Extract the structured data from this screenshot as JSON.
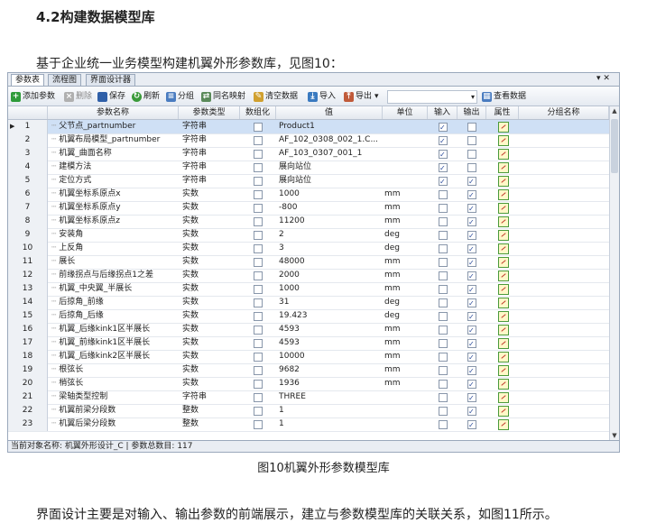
{
  "doc": {
    "heading": "4.2构建数据模型库",
    "intro": "基于企业统一业务模型构建机翼外形参数库，见图10：",
    "caption": "图10机翼外形参数模型库",
    "outro": "界面设计主要是对输入、输出参数的前端展示，建立与参数模型库的关联关系，如图11所示。"
  },
  "window": {
    "tabs": [
      "参数表",
      "流程图",
      "界面设计器"
    ],
    "controls": "▾ ✕"
  },
  "toolbar": {
    "add": "添加参数",
    "delete": "删除",
    "save": "保存",
    "refresh": "刷新",
    "group": "分组",
    "same_name_map": "同名映射",
    "clear_data": "清空数据",
    "import": "导入",
    "export": "导出",
    "export_arrow": "▾",
    "view_data": "查看数据"
  },
  "table": {
    "columns": [
      "参数名称",
      "参数类型",
      "数组化",
      "值",
      "单位",
      "输入",
      "输出",
      "属性",
      "分组名称"
    ],
    "rows": [
      {
        "n": "1",
        "name": "父节点_partnumber",
        "type": "字符串",
        "arr": false,
        "value": "Product1",
        "unit": "",
        "in": true,
        "out": false,
        "sel": true
      },
      {
        "n": "2",
        "name": "机翼布局模型_partnumber",
        "type": "字符串",
        "arr": false,
        "value": "AF_102_0308_002_1.C...",
        "unit": "",
        "in": true,
        "out": false
      },
      {
        "n": "3",
        "name": "机翼_曲面名称",
        "type": "字符串",
        "arr": false,
        "value": "AF_103_0307_001_1",
        "unit": "",
        "in": true,
        "out": false
      },
      {
        "n": "4",
        "name": "建模方法",
        "type": "字符串",
        "arr": false,
        "value": "展向站位",
        "unit": "",
        "in": true,
        "out": false
      },
      {
        "n": "5",
        "name": "定位方式",
        "type": "字符串",
        "arr": false,
        "value": "展向站位",
        "unit": "",
        "in": true,
        "out": true
      },
      {
        "n": "6",
        "name": "机翼坐标系原点x",
        "type": "实数",
        "arr": false,
        "value": "1000",
        "unit": "mm",
        "in": false,
        "out": true
      },
      {
        "n": "7",
        "name": "机翼坐标系原点y",
        "type": "实数",
        "arr": false,
        "value": "-800",
        "unit": "mm",
        "in": false,
        "out": true
      },
      {
        "n": "8",
        "name": "机翼坐标系原点z",
        "type": "实数",
        "arr": false,
        "value": "11200",
        "unit": "mm",
        "in": false,
        "out": true
      },
      {
        "n": "9",
        "name": "安装角",
        "type": "实数",
        "arr": false,
        "value": "2",
        "unit": "deg",
        "in": false,
        "out": true
      },
      {
        "n": "10",
        "name": "上反角",
        "type": "实数",
        "arr": false,
        "value": "3",
        "unit": "deg",
        "in": false,
        "out": true
      },
      {
        "n": "11",
        "name": "展长",
        "type": "实数",
        "arr": false,
        "value": "48000",
        "unit": "mm",
        "in": false,
        "out": true
      },
      {
        "n": "12",
        "name": "前缘拐点与后缘拐点1之差",
        "type": "实数",
        "arr": false,
        "value": "2000",
        "unit": "mm",
        "in": false,
        "out": true
      },
      {
        "n": "13",
        "name": "机翼_中央翼_半展长",
        "type": "实数",
        "arr": false,
        "value": "1000",
        "unit": "mm",
        "in": false,
        "out": true
      },
      {
        "n": "14",
        "name": "后掠角_前缘",
        "type": "实数",
        "arr": false,
        "value": "31",
        "unit": "deg",
        "in": false,
        "out": true
      },
      {
        "n": "15",
        "name": "后掠角_后缘",
        "type": "实数",
        "arr": false,
        "value": "19.423",
        "unit": "deg",
        "in": false,
        "out": true
      },
      {
        "n": "16",
        "name": "机翼_后缘kink1区半展长",
        "type": "实数",
        "arr": false,
        "value": "4593",
        "unit": "mm",
        "in": false,
        "out": true
      },
      {
        "n": "17",
        "name": "机翼_前缘kink1区半展长",
        "type": "实数",
        "arr": false,
        "value": "4593",
        "unit": "mm",
        "in": false,
        "out": true
      },
      {
        "n": "18",
        "name": "机翼_后缘kink2区半展长",
        "type": "实数",
        "arr": false,
        "value": "10000",
        "unit": "mm",
        "in": false,
        "out": true
      },
      {
        "n": "19",
        "name": "根弦长",
        "type": "实数",
        "arr": false,
        "value": "9682",
        "unit": "mm",
        "in": false,
        "out": true
      },
      {
        "n": "20",
        "name": "梢弦长",
        "type": "实数",
        "arr": false,
        "value": "1936",
        "unit": "mm",
        "in": false,
        "out": true
      },
      {
        "n": "21",
        "name": "梁轴类型控制",
        "type": "字符串",
        "arr": false,
        "value": "THREE",
        "unit": "",
        "in": false,
        "out": true
      },
      {
        "n": "22",
        "name": "机翼前梁分段数",
        "type": "整数",
        "arr": false,
        "value": "1",
        "unit": "",
        "in": false,
        "out": true
      },
      {
        "n": "23",
        "name": "机翼后梁分段数",
        "type": "整数",
        "arr": false,
        "value": "1",
        "unit": "",
        "in": false,
        "out": true
      }
    ]
  },
  "status": {
    "text": "当前对象名称:  机翼外形设计_C  |  参数总数目:  117"
  },
  "colors": {
    "selected_row": "#cfe0f5",
    "border": "#9aa8bb"
  }
}
